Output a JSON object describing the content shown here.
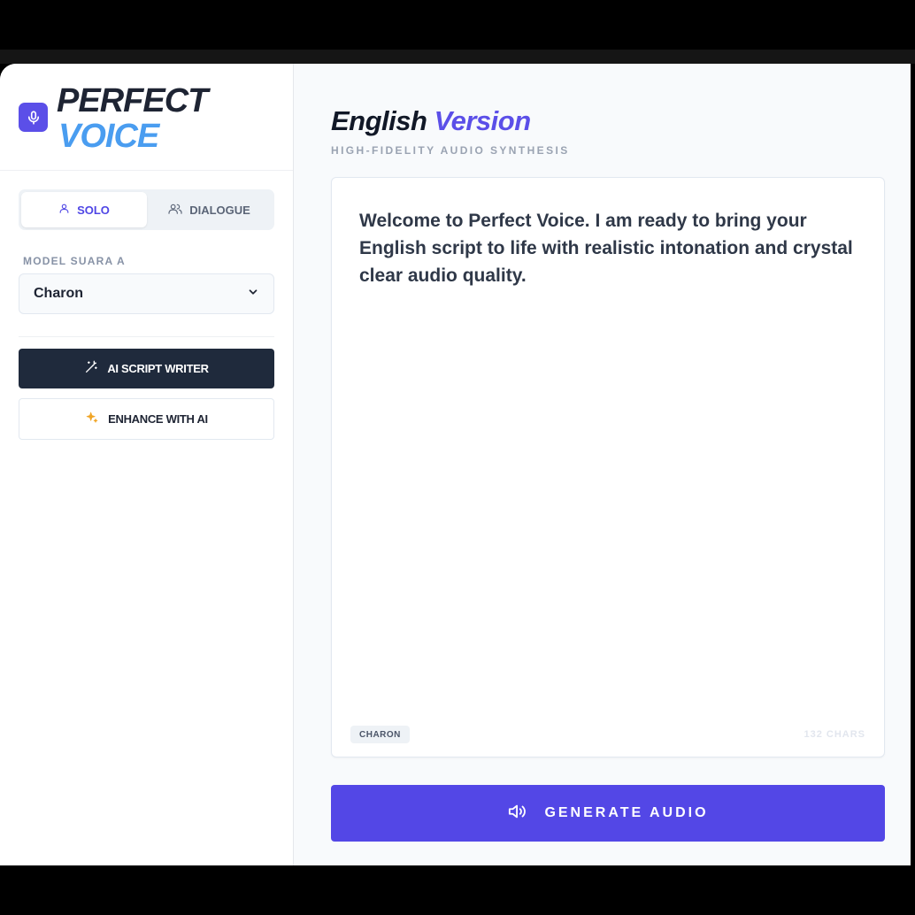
{
  "brand": {
    "line1": "PERFECT",
    "line2": "VOICE",
    "icon": "microphone-icon",
    "accent": "#5b4fe8",
    "highlight": "#4a9df0"
  },
  "mode_toggle": {
    "solo_label": "SOLO",
    "dialogue_label": "DIALOGUE",
    "selected": "SOLO"
  },
  "voice_model": {
    "label": "MODEL SUARA A",
    "selected": "Charon"
  },
  "actions": {
    "script_writer_label": "AI SCRIPT WRITER",
    "enhance_label": "ENHANCE WITH AI"
  },
  "main": {
    "title_part1": "English",
    "title_part2": "Version",
    "subtitle": "HIGH-FIDELITY AUDIO SYNTHESIS"
  },
  "editor": {
    "text": "Welcome to Perfect Voice. I am ready to bring your English script to life with realistic intonation and crystal clear audio quality.",
    "voice_badge": "CHARON",
    "char_count": "132 CHARS"
  },
  "generate": {
    "label": "GENERATE AUDIO",
    "color": "#5347e6"
  }
}
